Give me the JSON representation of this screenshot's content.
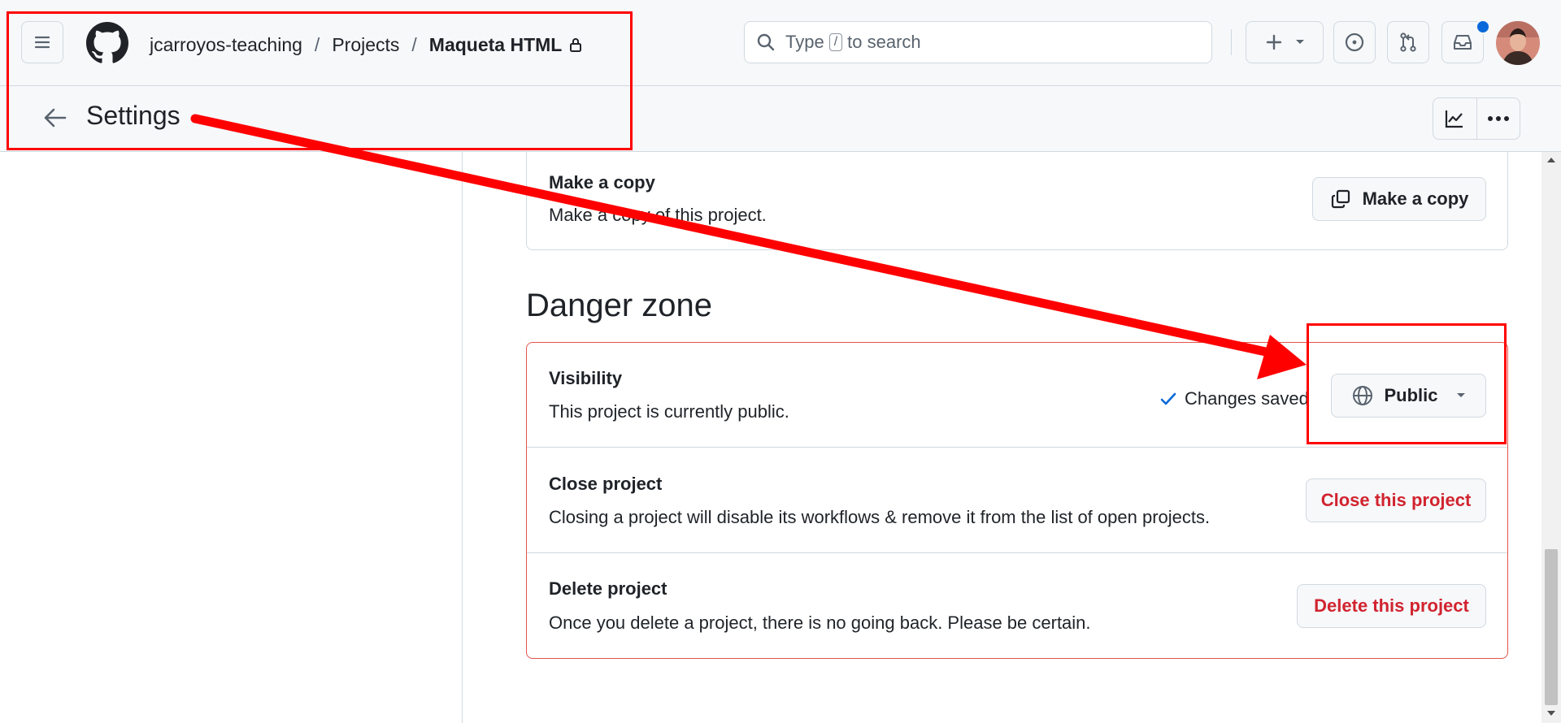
{
  "header": {
    "breadcrumbs": [
      "jcarroyos-teaching",
      "Projects",
      "Maqueta HTML"
    ],
    "separator": "/",
    "search": {
      "text_before": "Type",
      "key": "/",
      "text_after": "to search"
    }
  },
  "subheader": {
    "title": "Settings"
  },
  "make_copy": {
    "title": "Make a copy",
    "description": "Make a copy of this project.",
    "button": "Make a copy"
  },
  "danger_zone": {
    "title": "Danger zone",
    "visibility": {
      "title": "Visibility",
      "description": "This project is currently public.",
      "status": "Changes saved",
      "select": "Public"
    },
    "close": {
      "title": "Close project",
      "description": "Closing a project will disable its workflows & remove it from the list of open projects.",
      "button": "Close this project"
    },
    "delete": {
      "title": "Delete project",
      "description": "Once you delete a project, there is no going back. Please be certain.",
      "button": "Delete this project"
    }
  },
  "colors": {
    "danger": "#d1242f",
    "accent": "#0969da",
    "annotation": "#ff0000"
  },
  "icons": [
    "hamburger-icon",
    "github-logo-icon",
    "lock-icon",
    "search-icon",
    "plus-icon",
    "triangle-down-icon",
    "issue-icon",
    "pull-request-icon",
    "inbox-icon",
    "arrow-left-icon",
    "graph-icon",
    "kebab-icon",
    "copy-icon",
    "check-icon",
    "globe-icon"
  ]
}
